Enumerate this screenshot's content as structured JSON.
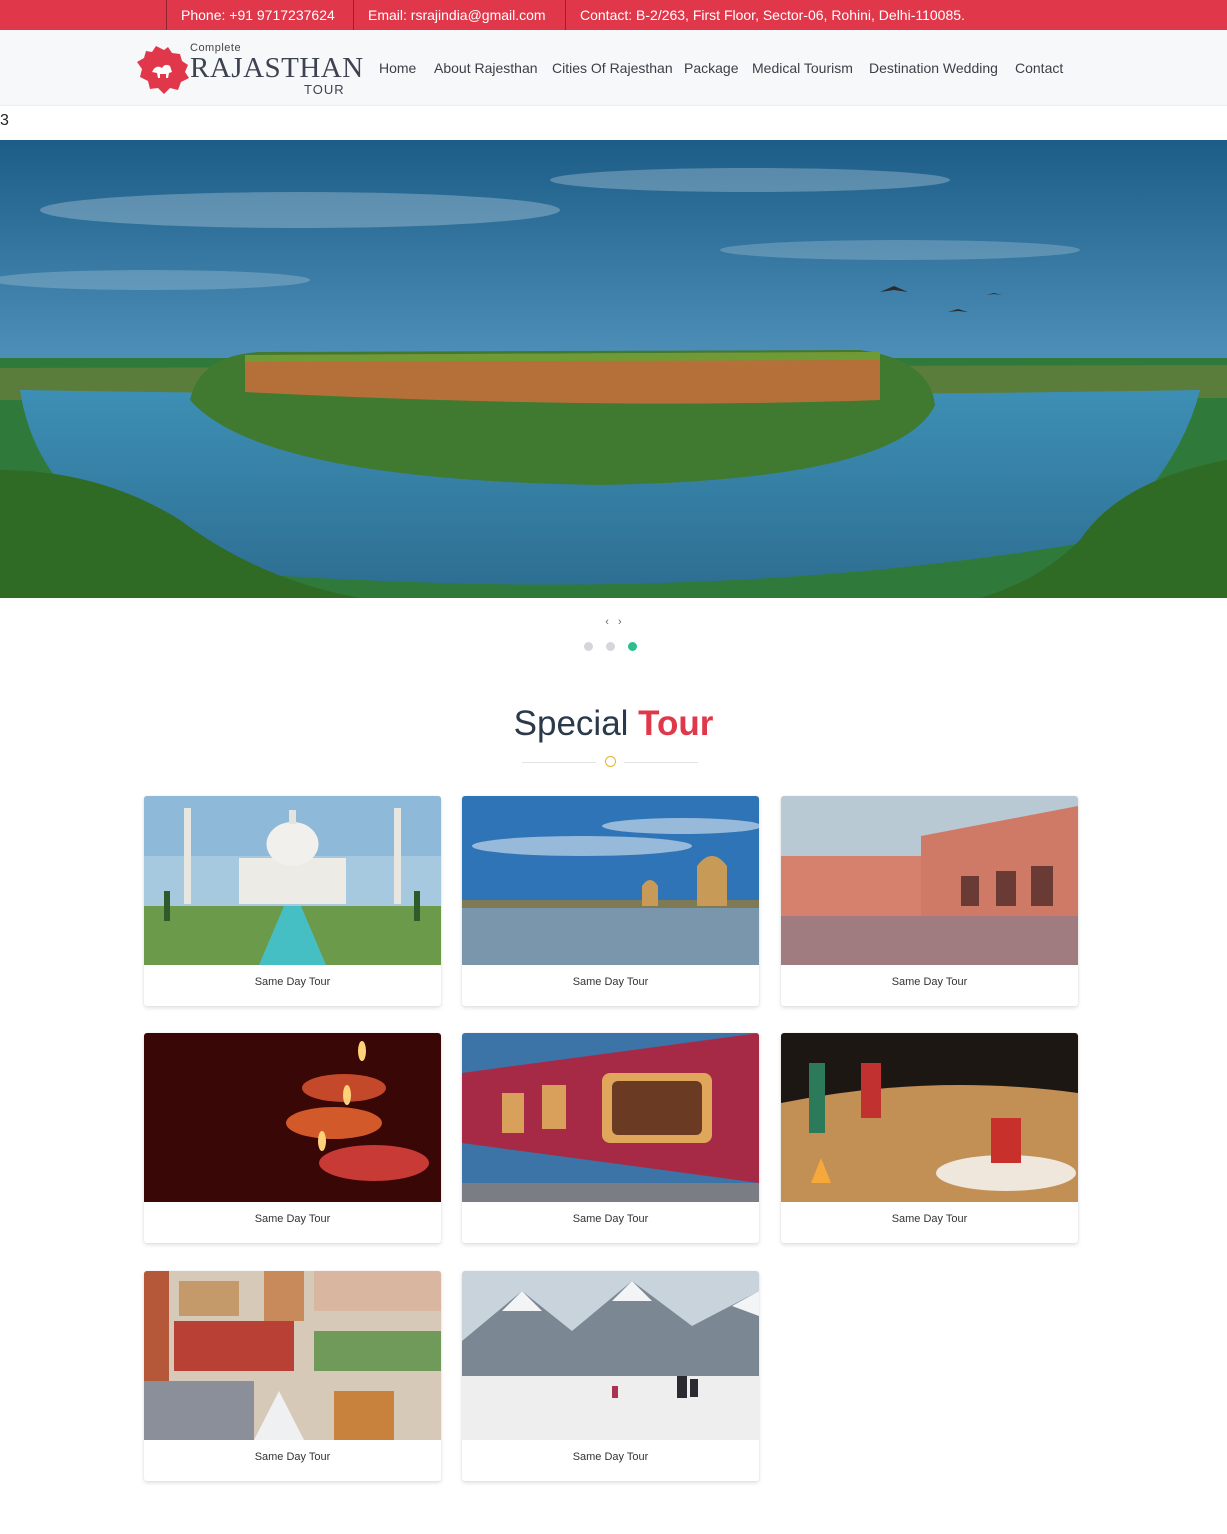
{
  "topbar": {
    "phone": "Phone: +91 9717237624",
    "email": "Email: rsrajindia@gmail.com",
    "contact": "Contact: B-2/263, First Floor, Sector-06, Rohini, Delhi-110085."
  },
  "logo": {
    "small": "Complete",
    "big": "RAJASTHAN",
    "tour": "TOUR"
  },
  "nav": {
    "items": [
      {
        "label": "Home"
      },
      {
        "label": "About Rajesthan"
      },
      {
        "label": "Cities Of Rajesthan"
      },
      {
        "label": "Package"
      },
      {
        "label": "Medical Tourism"
      },
      {
        "label": "Destination Wedding"
      },
      {
        "label": "Contact"
      }
    ]
  },
  "stray_text": "3",
  "slider": {
    "prev": "‹",
    "next": "›",
    "dot_count": 3,
    "active_dot": 3
  },
  "section": {
    "title_part1": "Special",
    "title_part2": "Tour"
  },
  "colors": {
    "brand_red": "#e0384a",
    "active_dot": "#2bbf8e",
    "divider_ring": "#e2b530"
  },
  "cards": [
    {
      "caption": "Same Day Tour",
      "image": "taj-mahal"
    },
    {
      "caption": "Same Day Tour",
      "image": "lake-palace"
    },
    {
      "caption": "Same Day Tour",
      "image": "city-palace"
    },
    {
      "caption": "Same Day Tour",
      "image": "diya-lamps"
    },
    {
      "caption": "Same Day Tour",
      "image": "royal-train"
    },
    {
      "caption": "Same Day Tour",
      "image": "desert-camp"
    },
    {
      "caption": "Same Day Tour",
      "image": "delhi-collage"
    },
    {
      "caption": "Same Day Tour",
      "image": "snow-mountains"
    }
  ]
}
